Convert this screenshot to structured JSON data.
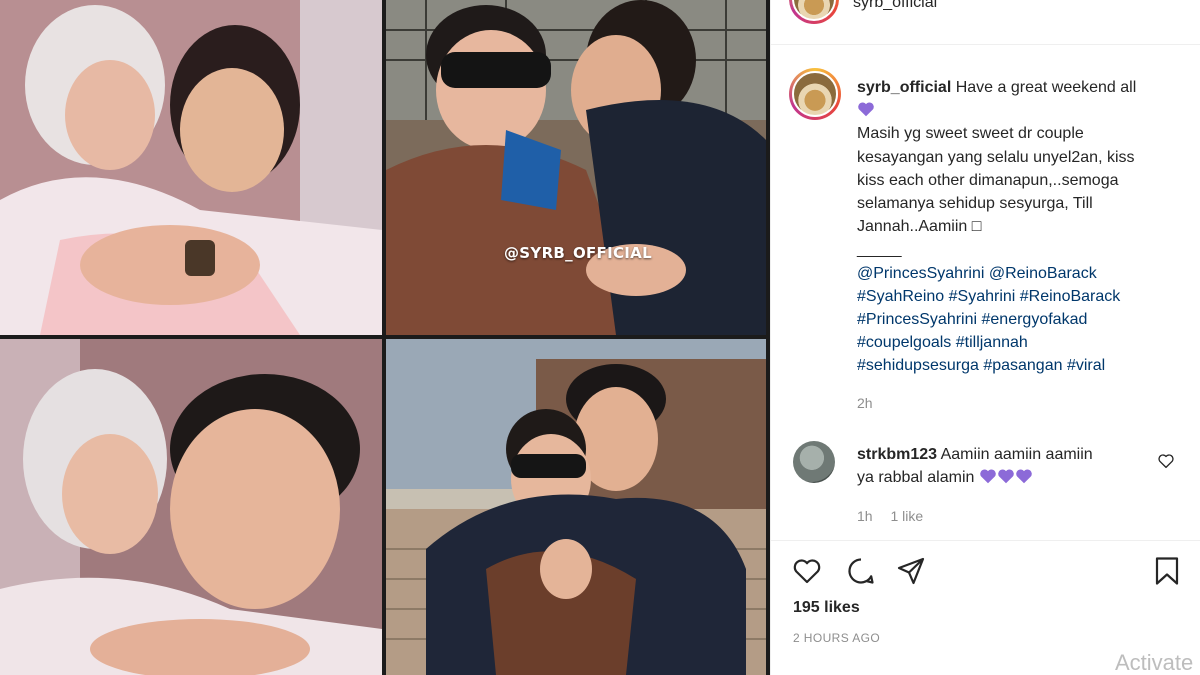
{
  "collage": {
    "watermark": "@SYRB_OFFICIAL"
  },
  "post": {
    "username": "syrb_official",
    "caption": {
      "first_line": "Have a great weekend all",
      "lines": [
        "Masih yg sweet sweet dr couple",
        "kesayangan yang selalu unyel2an, kiss",
        "kiss each other dimanapun,..semoga",
        "selamanya sehidup sesyurga, Till",
        "Jannah..Aamiin ",
        "_____"
      ],
      "box_glyph": "□",
      "tag_lines": [
        "@PrincesSyahrini @ReinoBarack",
        "#SyahReino #Syahrini #ReinoBarack",
        "#PrincesSyahrini #energyofakad",
        "#coupelgoals #tilljannah",
        "#sehidupsesurga #pasangan #viral"
      ]
    },
    "time": "2h",
    "likes": "195 likes",
    "time_ago": "2 HOURS AGO"
  },
  "comment": {
    "username": "strkbm123",
    "text_part1": "Aamiin aamiin aamiin",
    "text_part2": "ya rabbal alamin",
    "time": "1h",
    "likes": "1 like"
  },
  "system": {
    "watermark": "Activate"
  },
  "colors": {
    "purple_heart": "#8c6ad8",
    "tag_blue": "#00376b",
    "muted": "#8e8e8e"
  },
  "icons": [
    "heart-icon",
    "comment-bubble-icon",
    "share-icon",
    "bookmark-icon",
    "heart-outline-small-icon",
    "purple-heart-icon"
  ]
}
